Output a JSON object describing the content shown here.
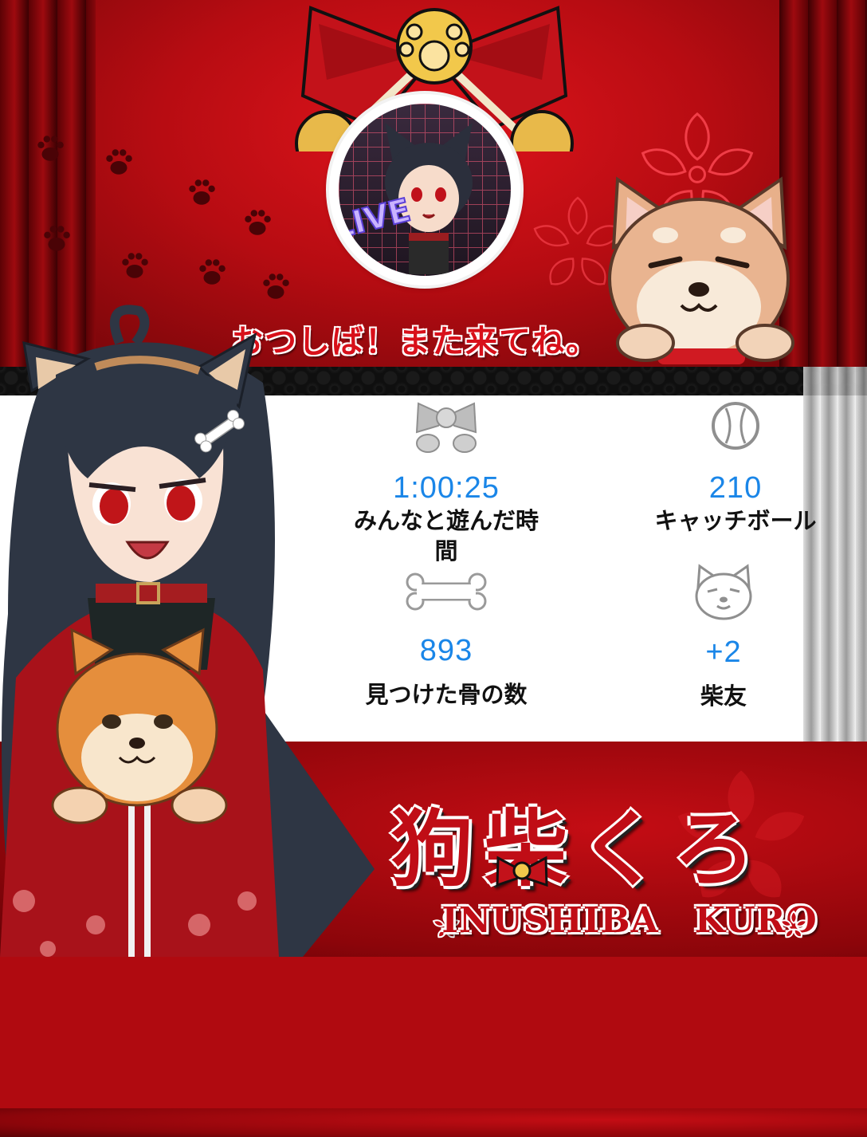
{
  "farewell_message": "おつしば！また来てね。",
  "stats": [
    {
      "icon": "bow-icon",
      "value": "1:00:25",
      "label": "みんなと遊んだ時間"
    },
    {
      "icon": "baseball-icon",
      "value": "210",
      "label": "キャッチボール"
    },
    {
      "icon": "bone-icon",
      "value": "893",
      "label": "見つけた骨の数"
    },
    {
      "icon": "shiba-face-icon",
      "value": "+2",
      "label": "柴友"
    }
  ],
  "avatar_badge_text": "LIVE",
  "logo": {
    "japanese": "狗柴くろ",
    "english": "INUSHIBA　KURO"
  },
  "colors": {
    "accent_red": "#d8101a",
    "value_blue": "#1a86e8",
    "panel_bg": "#ffffff"
  }
}
